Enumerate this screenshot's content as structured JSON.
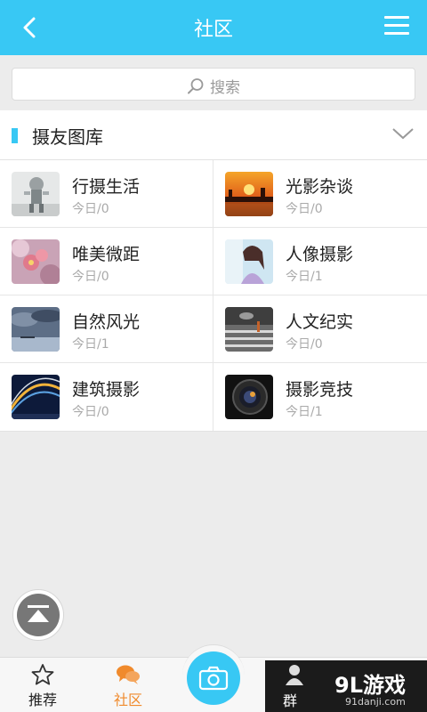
{
  "header": {
    "title": "社区"
  },
  "search": {
    "placeholder": "搜索"
  },
  "section": {
    "title": "摄友图库"
  },
  "boards": [
    {
      "name": "行摄生活",
      "count": "今日/0",
      "thumb": "robot-photo"
    },
    {
      "name": "光影杂谈",
      "count": "今日/0",
      "thumb": "sunset-photo"
    },
    {
      "name": "唯美微距",
      "count": "今日/0",
      "thumb": "flower-macro-photo"
    },
    {
      "name": "人像摄影",
      "count": "今日/1",
      "thumb": "portrait-photo"
    },
    {
      "name": "自然风光",
      "count": "今日/1",
      "thumb": "cloudy-lake-photo"
    },
    {
      "name": "人文纪实",
      "count": "今日/0",
      "thumb": "street-photo"
    },
    {
      "name": "建筑摄影",
      "count": "今日/0",
      "thumb": "architecture-photo"
    },
    {
      "name": "摄影竞技",
      "count": "今日/1",
      "thumb": "camera-lens-photo"
    }
  ],
  "tabs": [
    {
      "label": "推荐",
      "icon": "star-icon",
      "active": false
    },
    {
      "label": "社区",
      "icon": "chat-bubbles-icon",
      "active": true
    },
    {
      "label": "群",
      "icon": "group-icon",
      "active": false
    }
  ],
  "watermark": {
    "logo": "9L游戏",
    "site": "91danji.com"
  },
  "colors": {
    "accent": "#38c8f4",
    "active_tab": "#f08a2c",
    "text": "#222222",
    "muted": "#aaaaaa"
  }
}
